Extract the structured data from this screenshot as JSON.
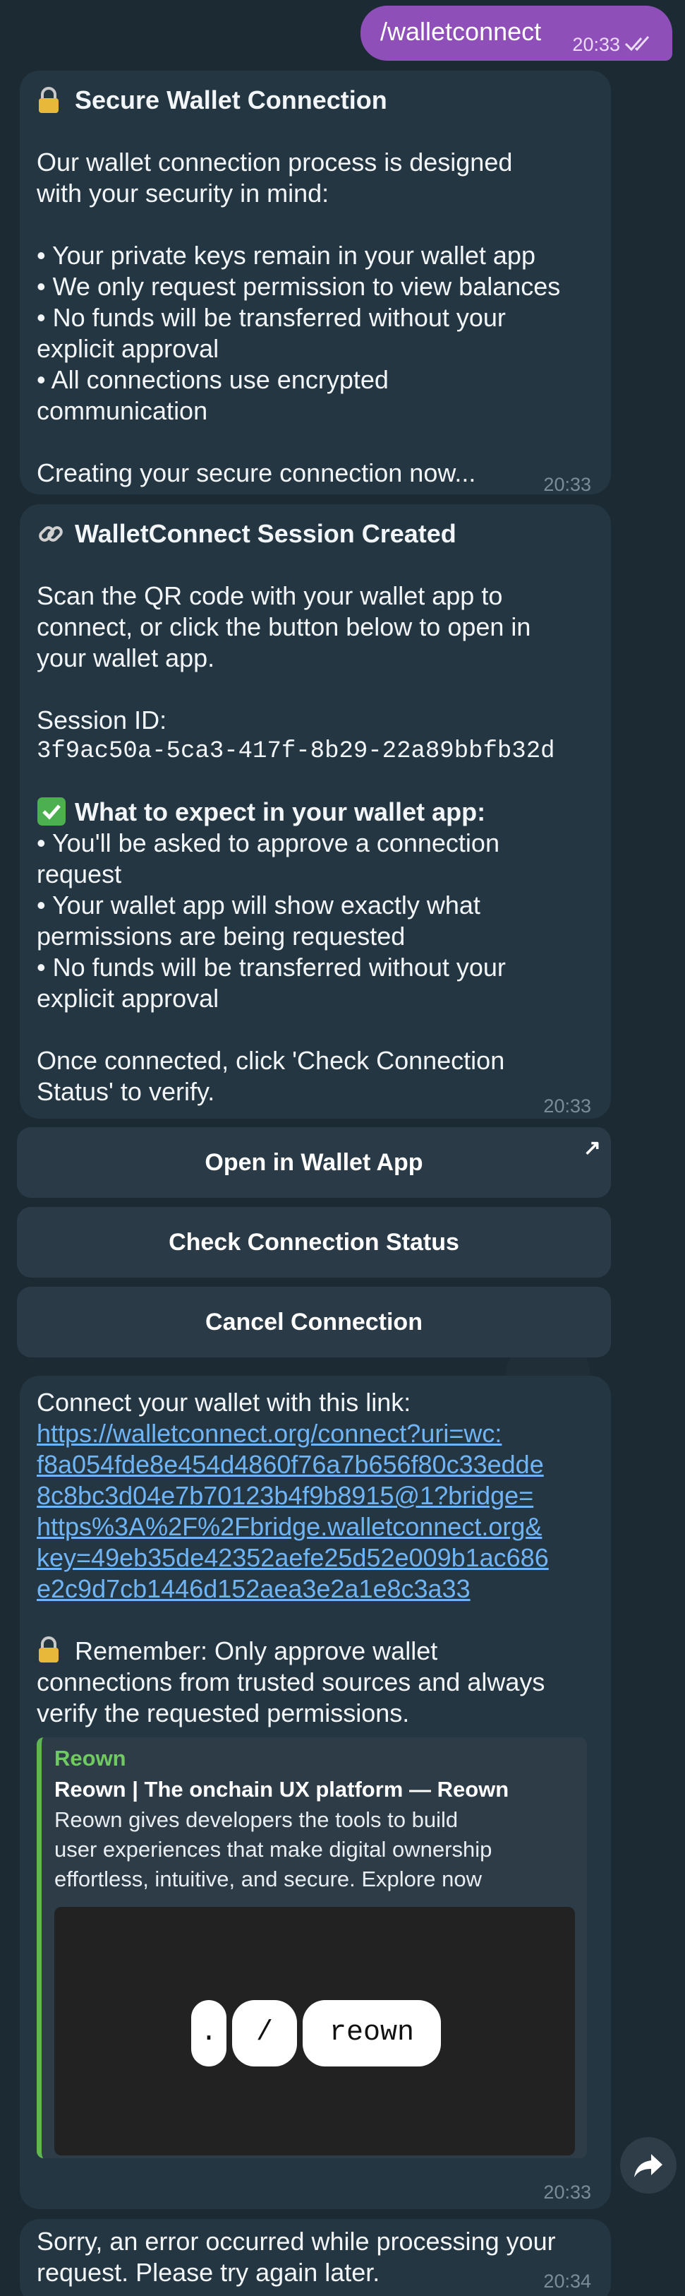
{
  "colors": {
    "background": "#1b2a33",
    "outgoing_bubble": "#8f4fb8",
    "incoming_bubble": "#253643",
    "link": "#6fb4f5",
    "preview_accent": "#5fb752"
  },
  "outgoing": {
    "text": "/walletconnect",
    "time": "20:33",
    "status_icon": "double-check-icon"
  },
  "msg1": {
    "title": "Secure Wallet Connection",
    "title_icon": "lock-icon",
    "intro_1": "Our wallet connection process is designed",
    "intro_2": "with your security in mind:",
    "b1": "• Your private keys remain in your wallet app",
    "b2": "• We only request permission to view balances",
    "b3a": "• No funds will be transferred without your",
    "b3b": "explicit approval",
    "b4a": "• All connections use encrypted",
    "b4b": "communication",
    "footer": "Creating your secure connection now...",
    "time": "20:33"
  },
  "msg2": {
    "title": "WalletConnect Session Created",
    "title_icon": "link-icon",
    "p1": "Scan the QR code with your wallet app to",
    "p2": "connect, or click the button below to open in",
    "p3": "your wallet app.",
    "session_label": "Session ID:",
    "session_id": "3f9ac50a-5ca3-417f-8b29-22a89bbfb32d",
    "expect_title": "What to expect in your wallet app:",
    "expect_icon": "check-box-icon",
    "e1a": "• You'll be asked to approve a connection",
    "e1b": "request",
    "e2a": "• Your wallet app will show exactly what",
    "e2b": "permissions are being requested",
    "e3a": "• No funds will be transferred without your",
    "e3b": "explicit approval",
    "f1": "Once connected, click 'Check Connection",
    "f2": "Status' to verify.",
    "time": "20:33"
  },
  "keyboard": {
    "open": "Open in Wallet App",
    "open_icon": "external-arrow-icon",
    "check": "Check Connection Status",
    "cancel": "Cancel Connection"
  },
  "msg3": {
    "intro": "Connect your wallet with this link:",
    "link_1": "https://walletconnect.org/connect?uri=wc:",
    "link_2": "f8a054fde8e454d4860f76a7b656f80c33edde",
    "link_3": "8c8bc3d04e7b70123b4f9b8915@1?bridge=",
    "link_4": "https%3A%2F%2Fbridge.walletconnect.org&",
    "link_5": "key=49eb35de42352aefe25d52e009b1ac686",
    "link_6": "e2c9d7cb1446d152aea3e2a1e8c3a33",
    "remember_1": "Remember: Only approve wallet",
    "remember_2": "connections from trusted sources and always",
    "remember_3": "verify the requested permissions.",
    "remember_icon": "lock-icon",
    "preview": {
      "site": "Reown",
      "title": "Reown | The onchain UX platform — Reown",
      "desc_1": "Reown gives developers the tools to build",
      "desc_2": "user experiences that make digital ownership",
      "desc_3": "effortless, intuitive, and secure. Explore now",
      "logo_dot": ".",
      "logo_slash": "/",
      "logo_word": "reown"
    },
    "time": "20:33"
  },
  "msg4": {
    "l1": "Sorry, an error occurred while processing your",
    "l2": "request. Please try again later.",
    "time": "20:34"
  },
  "share_icon": "share-arrow-icon"
}
